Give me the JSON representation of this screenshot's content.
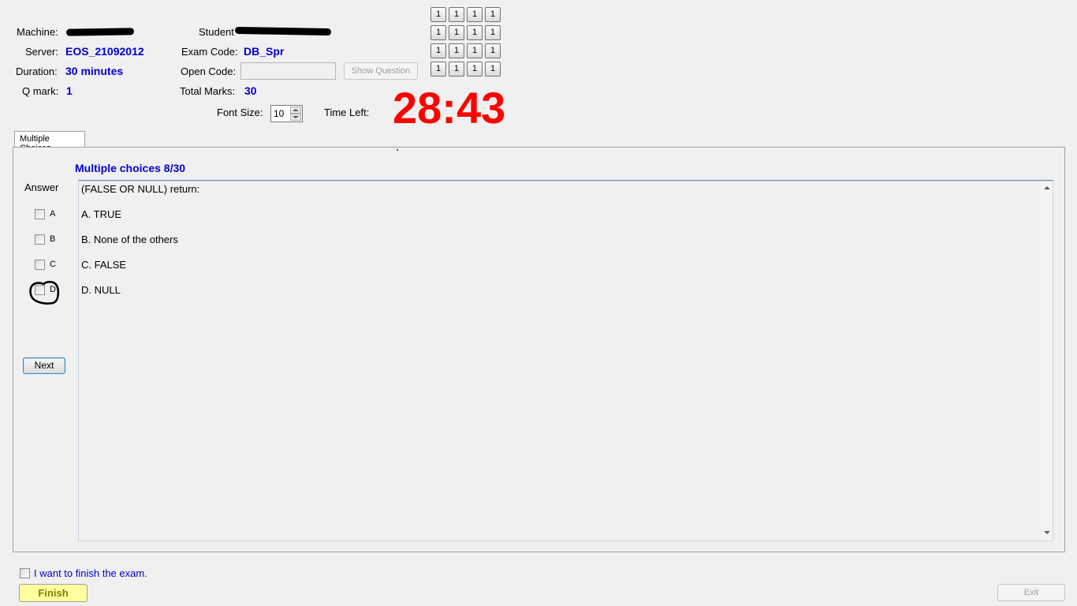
{
  "header": {
    "machine_label": "Machine:",
    "server_label": "Server:",
    "server_value": "EOS_21092012",
    "duration_label": "Duration:",
    "duration_value": "30 minutes",
    "qmark_label": "Q mark:",
    "qmark_value": "1",
    "student_label": "Student",
    "exam_code_label": "Exam Code:",
    "exam_code_value": "DB_Spr",
    "open_code_label": "Open Code:",
    "open_code_value": "",
    "show_question_label": "Show Question",
    "total_marks_label": "Total Marks:",
    "total_marks_value": "30",
    "font_size_label": "Font Size:",
    "font_size_value": "10",
    "time_left_label": "Time Left:",
    "timer_value": "28:43"
  },
  "grid_buttons": [
    "1",
    "1",
    "1",
    "1",
    "1",
    "1",
    "1",
    "1",
    "1",
    "1",
    "1",
    "1",
    "1",
    "1",
    "1",
    "1"
  ],
  "tabs": [
    {
      "label": "Multiple Choices"
    }
  ],
  "question": {
    "heading": "Multiple choices 8/30",
    "answer_label": "Answer",
    "stem": "(FALSE OR NULL) return:",
    "options": [
      {
        "letter": "A",
        "text": "A.  TRUE"
      },
      {
        "letter": "B",
        "text": "B.  None of the others"
      },
      {
        "letter": "C",
        "text": "C.  FALSE"
      },
      {
        "letter": "D",
        "text": "D.  NULL"
      }
    ],
    "next_label": "Next"
  },
  "footer": {
    "finish_check_label": "I want to finish the exam.",
    "finish_label": "Finish",
    "exit_label": "Exit"
  },
  "colors": {
    "value_blue": "#0000cc",
    "timer_red": "#ff0000",
    "finish_bg": "#ffffa0",
    "finish_text": "#808000"
  }
}
